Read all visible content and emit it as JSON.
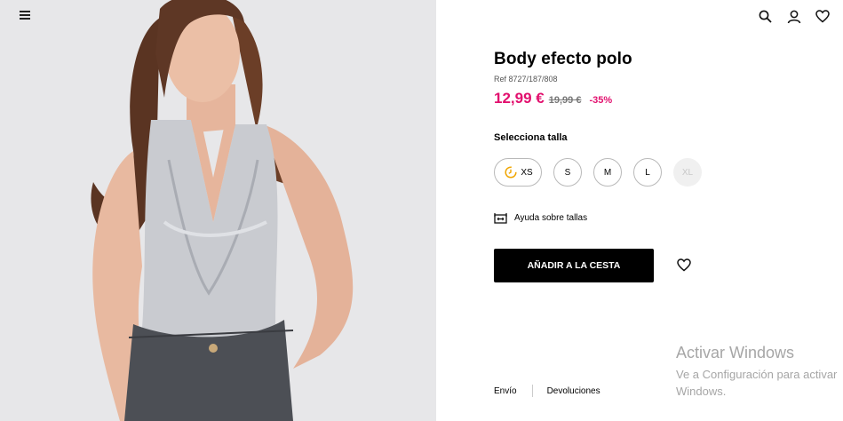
{
  "product": {
    "title": "Body efecto polo",
    "ref": "Ref 8727/187/808",
    "price_current": "12,99 €",
    "price_original": "19,99 €",
    "discount": "-35%"
  },
  "sizes": {
    "label": "Selecciona talla",
    "options": [
      "XS",
      "S",
      "M",
      "L",
      "XL"
    ],
    "low_stock": "XS",
    "unavailable": "XL"
  },
  "help": {
    "label": "Ayuda sobre tallas"
  },
  "cart": {
    "add_label": "AÑADIR A LA CESTA"
  },
  "footer_links": {
    "shipping": "Envío",
    "returns": "Devoluciones"
  },
  "watermark": {
    "line1": "Activar Windows",
    "line2": "Ve a Configuración para activar",
    "line3": "Windows."
  },
  "icons": {
    "menu": "hamburger-icon",
    "search": "search-icon",
    "account": "user-icon",
    "wishlist": "heart-icon",
    "size_help": "ruler-icon",
    "low_stock": "clock-icon"
  },
  "colors": {
    "sale": "#e2106e",
    "button": "#000000",
    "image_bg": "#e7e7e9"
  }
}
